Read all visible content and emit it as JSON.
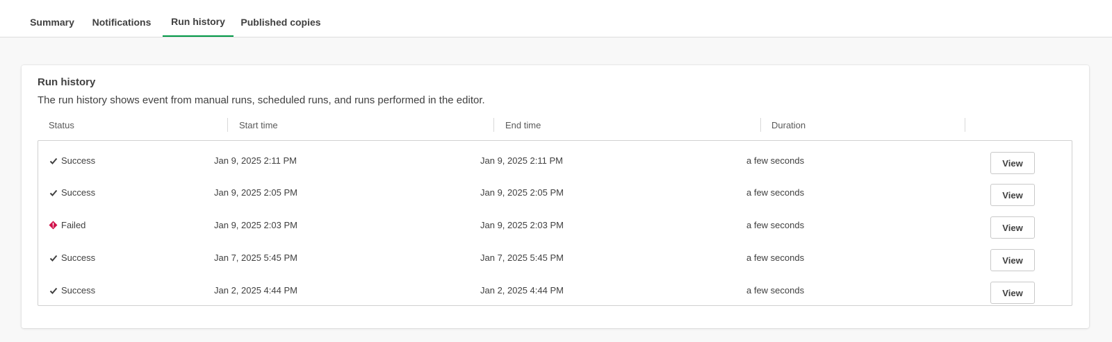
{
  "tabs": [
    {
      "label": "Summary"
    },
    {
      "label": "Notifications"
    },
    {
      "label": "Run history"
    },
    {
      "label": "Published copies"
    }
  ],
  "active_tab": "Run history",
  "card": {
    "title": "Run history",
    "description": "The run history shows event from manual runs, scheduled runs, and runs performed in the editor."
  },
  "table": {
    "headers": [
      "Status",
      "Start time",
      "End time",
      "Duration"
    ],
    "rows": [
      {
        "status": "Success",
        "status_icon": "checkmark-icon",
        "start": "Jan 9, 2025 2:11 PM",
        "end": "Jan 9, 2025 2:11 PM",
        "duration": "a few seconds",
        "action": "View"
      },
      {
        "status": "Success",
        "status_icon": "checkmark-icon",
        "start": "Jan 9, 2025 2:05 PM",
        "end": "Jan 9, 2025 2:05 PM",
        "duration": "a few seconds",
        "action": "View"
      },
      {
        "status": "Failed",
        "status_icon": "warning-diamond-icon",
        "start": "Jan 9, 2025 2:03 PM",
        "end": "Jan 9, 2025 2:03 PM",
        "duration": "a few seconds",
        "action": "View"
      },
      {
        "status": "Success",
        "status_icon": "checkmark-icon",
        "start": "Jan 7, 2025 5:45 PM",
        "end": "Jan 7, 2025 5:45 PM",
        "duration": "a few seconds",
        "action": "View"
      },
      {
        "status": "Success",
        "status_icon": "checkmark-icon",
        "start": "Jan 2, 2025 4:44 PM",
        "end": "Jan 2, 2025 4:44 PM",
        "duration": "a few seconds",
        "action": "View"
      }
    ]
  },
  "colors": {
    "accent": "#009845",
    "failed": "#d0104a",
    "success": "#404040"
  }
}
